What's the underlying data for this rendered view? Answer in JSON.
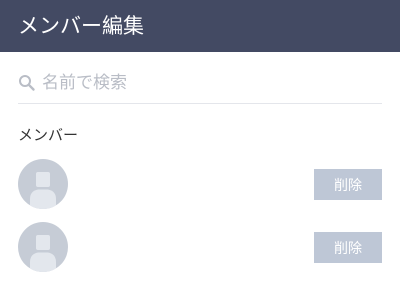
{
  "header": {
    "title": "メンバー編集"
  },
  "search": {
    "placeholder": "名前で検索",
    "value": "",
    "icon": "search-icon"
  },
  "members_section": {
    "label": "メンバー",
    "members": [
      {
        "avatar": "default-avatar-icon",
        "delete_label": "削除"
      },
      {
        "avatar": "default-avatar-icon",
        "delete_label": "削除"
      }
    ]
  },
  "colors": {
    "header_bg": "#434a63",
    "avatar_bg": "#c6ccd6",
    "button_bg": "#bec7d6"
  }
}
